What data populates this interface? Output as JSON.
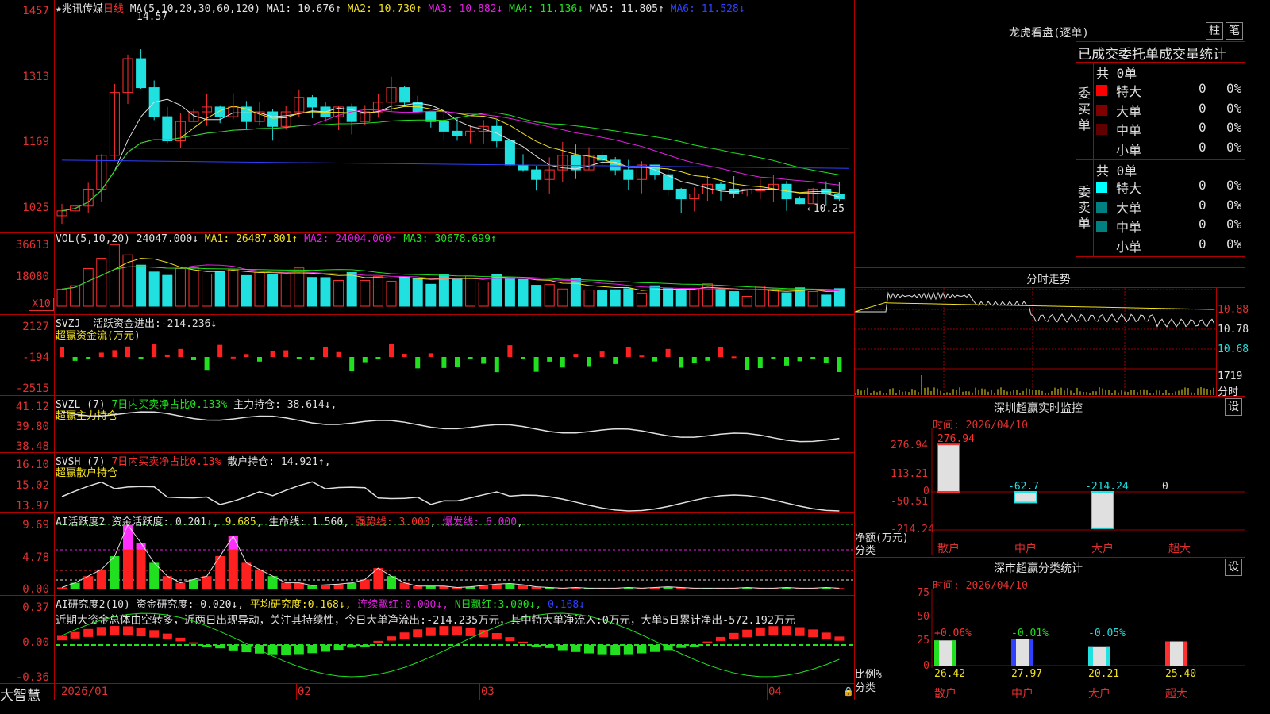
{
  "stock": {
    "name": "兆讯传媒",
    "period": "日线",
    "star": "★"
  },
  "kline": {
    "ma_params": "MA(5,10,20,30,60,120)",
    "ma": [
      {
        "k": "MA1:",
        "v": "10.676",
        "a": "↑",
        "c": "w"
      },
      {
        "k": "MA2:",
        "v": "10.730",
        "a": "↑",
        "c": "y"
      },
      {
        "k": "MA3:",
        "v": "10.882",
        "a": "↓",
        "c": "m"
      },
      {
        "k": "MA4:",
        "v": "11.136",
        "a": "↓",
        "c": "g"
      },
      {
        "k": "MA5:",
        "v": "11.805",
        "a": "↑",
        "c": "w"
      },
      {
        "k": "MA6:",
        "v": "11.528",
        "a": "↓",
        "c": "b"
      }
    ],
    "axis": [
      "1457",
      "1313",
      "1169",
      "1025"
    ],
    "high_label": "14.57",
    "low_label": "←10.25"
  },
  "vol": {
    "params": "VOL(5,10,20)",
    "v": "24047.000",
    "va": "↓",
    "ma": [
      {
        "k": "MA1:",
        "v": "26487.801",
        "a": "↑",
        "c": "y"
      },
      {
        "k": "MA2:",
        "v": "24004.000",
        "a": "↑",
        "c": "m"
      },
      {
        "k": "MA3:",
        "v": "30678.699",
        "a": "↑",
        "c": "g"
      }
    ],
    "axis": [
      "36613",
      "18080"
    ],
    "unit": "X10"
  },
  "svzj": {
    "name": "SVZJ",
    "label": "活跃资金进出:",
    "v": "-214.236",
    "a": "↓",
    "sub": "超赢资金流(万元)",
    "axis": [
      "2127",
      "-194",
      "-2515"
    ]
  },
  "svzl": {
    "name": "SVZL (7)",
    "t1": "7日内买卖净占比0.133%",
    "t2": "主力持仓:",
    "v": "38.614",
    "a": "↓,",
    "sub": "超赢主力持仓",
    "axis": [
      "41.12",
      "39.80",
      "38.48"
    ]
  },
  "svsh": {
    "name": "SVSH (7)",
    "t1": "7日内买卖净占比0.13%",
    "t2": "散户持仓:",
    "v": "14.921",
    "a": "↑,",
    "sub": "超赢散户持仓",
    "axis": [
      "16.10",
      "15.02",
      "13.97"
    ]
  },
  "ai1": {
    "name": "AI活跃度2",
    "t1": "资金活跃度:",
    "v1": "0.201",
    "a1": "↓,",
    "v2": "9.685",
    "t3": "生命线:",
    "v3": "1.560",
    "t4": "强势线:",
    "v4": "3.000",
    "t5": "爆发线:",
    "v5": "6.000",
    "axis": [
      "9.69",
      "4.78",
      "0.00"
    ]
  },
  "ai2": {
    "name": "AI研究度2(10)",
    "t1": "资金研究度:",
    "v1": "-0.020",
    "a1": "↓,",
    "t2": "平均研究度:",
    "v2": "0.168",
    "a2": "↓,",
    "t3": "连续飘红:",
    "v3": "0.000",
    "a3": "↓,",
    "t4": "N日飘红:",
    "v4": "3.000",
    "a4": "↓,",
    "v5": "0.168",
    "a5": "↓",
    "comment": "近期大资金总体由空转多，近两日出现异动，关注其持续性，今日大单净流出:-214.235万元，其中特大单净流入:0万元，大单5日累计净出-572.192万元",
    "axis": [
      "0.37",
      "0.00",
      "-0.36"
    ]
  },
  "dates": [
    "2026/01",
    "02",
    "03",
    "04"
  ],
  "brand": "大智慧",
  "right": {
    "lhb_title": "龙虎看盘(逐单)",
    "btn1": "柱",
    "btn2": "笔",
    "stat_title": "已成交委托单成交量统计",
    "buy_side": "委买单",
    "sell_side": "委卖单",
    "buy_total": "共 0单",
    "sell_total": "共 0单",
    "rows_buy": [
      {
        "n": "特大",
        "q": "0",
        "p": "0%",
        "color": "#ff0000"
      },
      {
        "n": "大单",
        "q": "0",
        "p": "0%",
        "color": "#800000"
      },
      {
        "n": "中单",
        "q": "0",
        "p": "0%",
        "color": "#600000"
      },
      {
        "n": "小单",
        "q": "0",
        "p": "0%",
        "color": "#000000"
      }
    ],
    "rows_sell": [
      {
        "n": "特大",
        "q": "0",
        "p": "0%",
        "color": "#00ffff"
      },
      {
        "n": "大单",
        "q": "0",
        "p": "0%",
        "color": "#008080"
      },
      {
        "n": "中单",
        "q": "0",
        "p": "0%",
        "color": "#008080"
      },
      {
        "n": "小单",
        "q": "0",
        "p": "0%",
        "color": "#000000"
      }
    ],
    "fenshi_title": "分时走势",
    "fenshi_axis": [
      "10.88",
      "10.78",
      "10.68"
    ],
    "fenshi_vol": "1719",
    "fenshi_unit": "分时",
    "mon_title": "深圳超赢实时监控",
    "mon_btn": "设",
    "mon_time": "时间: 2026/04/10",
    "mon_axis": [
      "276.94",
      "113.21",
      "0",
      "-50.51",
      "-214.24"
    ],
    "mon_ylab": "净额(万元)",
    "mon_xlab": "分类",
    "mon_vals": [
      "276.94",
      "-62.7",
      "-214.24",
      "0"
    ],
    "mon_cats": [
      "散户",
      "中户",
      "大户",
      "超大"
    ],
    "cls_title": "深市超赢分类统计",
    "cls_btn": "设",
    "cls_time": "时间: 2026/04/10",
    "cls_axis": [
      "75",
      "50",
      "25",
      "0"
    ],
    "cls_top": [
      "+0.06%",
      "-0.01%",
      "-0.05%"
    ],
    "cls_vals": [
      "26.42",
      "27.97",
      "20.21",
      "25.40"
    ],
    "cls_cats": [
      "散户",
      "中户",
      "大户",
      "超大"
    ],
    "cls_ylab": "比例%",
    "cls_xlab": "分类"
  }
}
